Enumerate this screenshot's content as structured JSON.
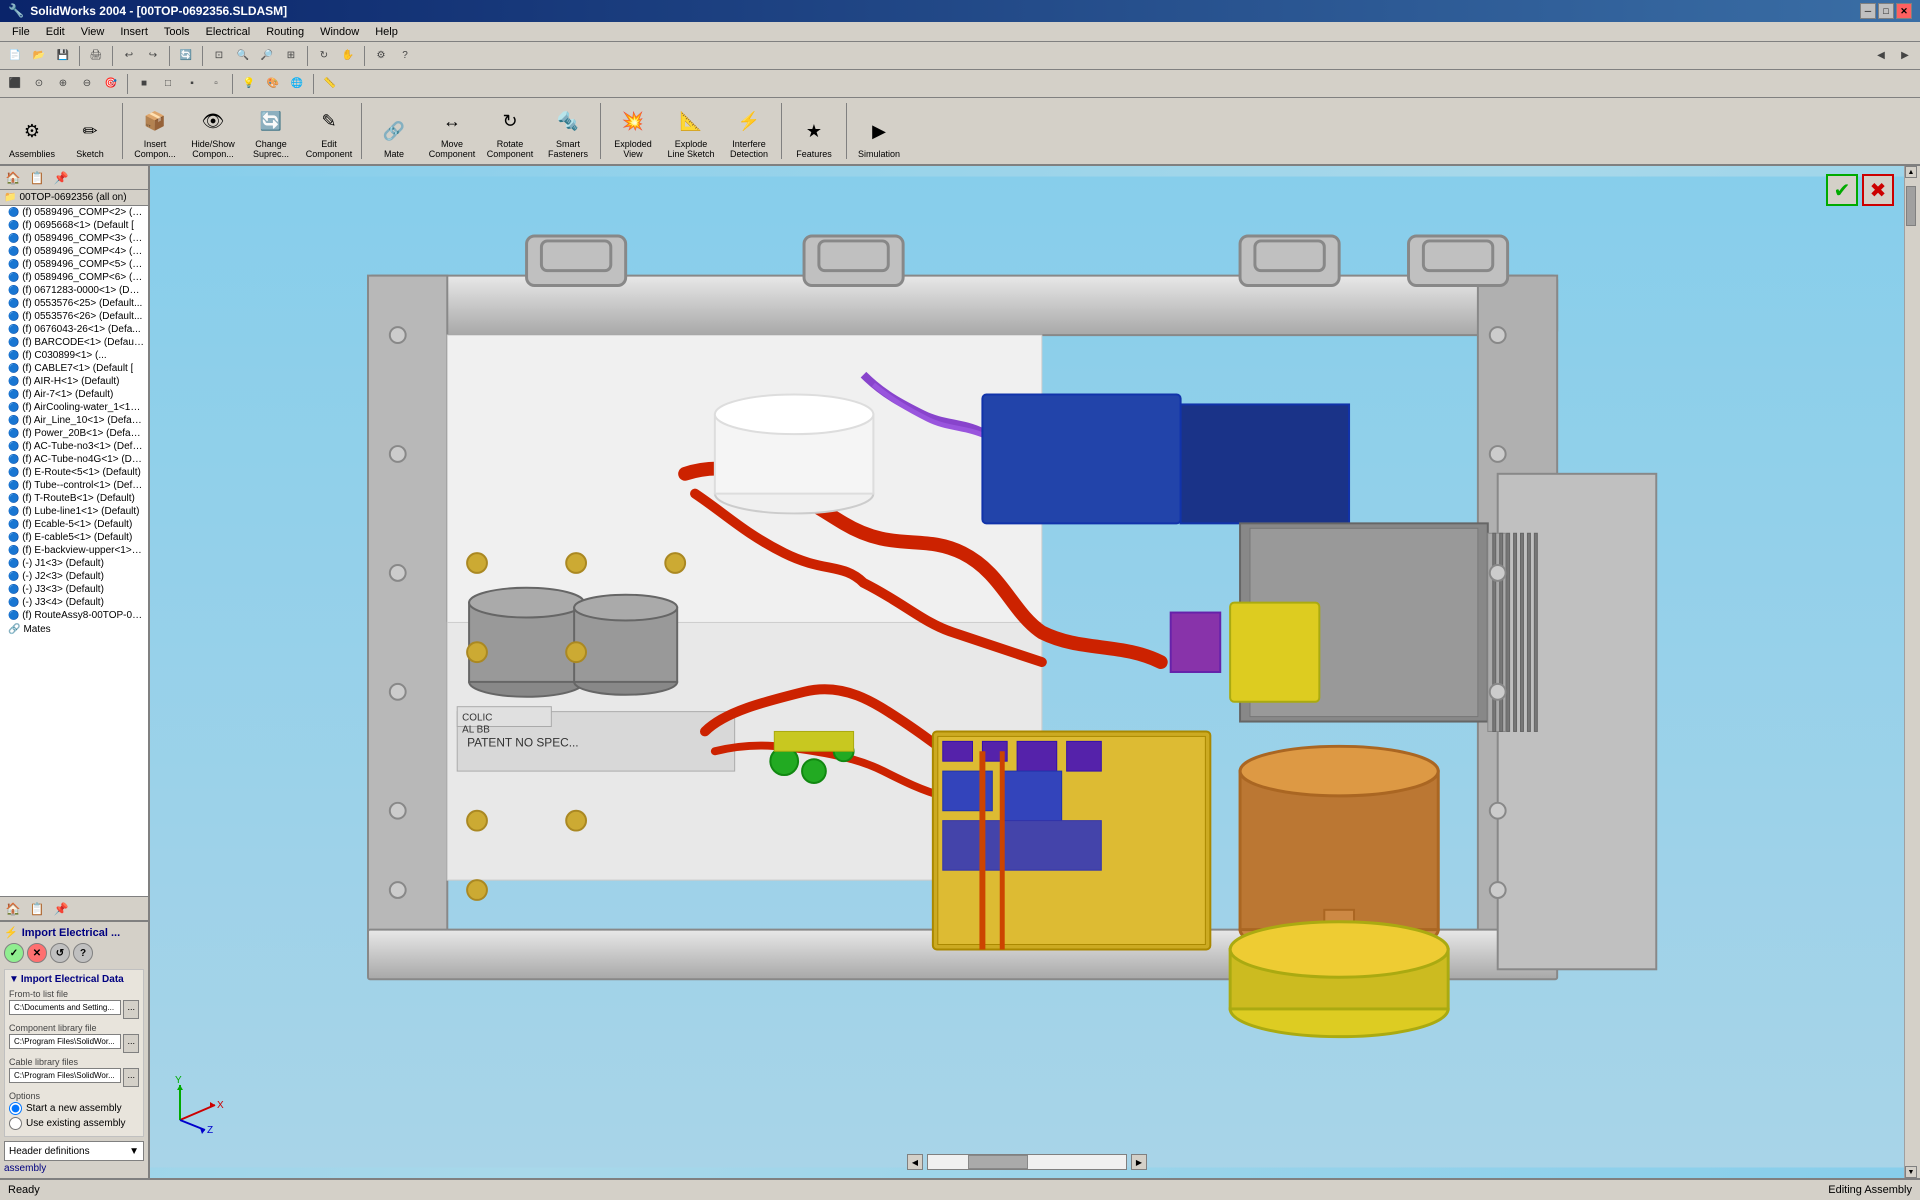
{
  "titlebar": {
    "title": "SolidWorks 2004 - [00TOP-0692356.SLDASM]",
    "min_label": "─",
    "max_label": "□",
    "close_label": "✕"
  },
  "menubar": {
    "items": [
      "File",
      "Edit",
      "View",
      "Insert",
      "Tools",
      "Electrical",
      "Routing",
      "Window",
      "Help"
    ]
  },
  "assembly_toolbar": {
    "buttons": [
      {
        "id": "assemblies",
        "label": "Assemblies",
        "icon": "⚙"
      },
      {
        "id": "sketch",
        "label": "Sketch",
        "icon": "✏"
      },
      {
        "id": "insert",
        "label": "Insert\nCompon...",
        "icon": "📦"
      },
      {
        "id": "hideshow",
        "label": "Hide/Show\nCompon...",
        "icon": "👁"
      },
      {
        "id": "change",
        "label": "Change\nSuprec...",
        "icon": "🔄"
      },
      {
        "id": "edit",
        "label": "Edit\nComponent",
        "icon": "✎"
      },
      {
        "id": "mate",
        "label": "Mate",
        "icon": "🔗"
      },
      {
        "id": "move",
        "label": "Move\nComponent",
        "icon": "↔"
      },
      {
        "id": "rotate",
        "label": "Rotate\nComponent",
        "icon": "↻"
      },
      {
        "id": "smartfasteners",
        "label": "Smart\nFasteners",
        "icon": "🔩"
      },
      {
        "id": "exploded",
        "label": "Exploded\nView",
        "icon": "💥"
      },
      {
        "id": "explode",
        "label": "Explode\nLine Sketch",
        "icon": "📐"
      },
      {
        "id": "interference",
        "label": "Interfere\nDetection",
        "icon": "⚡"
      },
      {
        "id": "features",
        "label": "Features",
        "icon": "★"
      },
      {
        "id": "simulation",
        "label": "Simulation",
        "icon": "▶"
      }
    ]
  },
  "tree": {
    "root": "00TOP-0692356 (all on)",
    "items": [
      "(f) 0589496_COMP<2> (De...",
      "(f) 0695668<1> (Default [",
      "(f) 0589496_COMP<3> (De...",
      "(f) 0589496_COMP<4> (De...",
      "(f) 0589496_COMP<5> (De...",
      "(f) 0589496_COMP<6> (De...",
      "(f) 0671283-0000<1> (Def...",
      "(f) 0553576<25> (Default...",
      "(f) 0553576<26> (Default...",
      "(f) 0676043-26<1> (Defa...",
      "(f) BARCODE<1> (Default...",
      "(f) C030899<1> (...",
      "(f) CABLE7<1> (Default [",
      "(f) AIR-H<1> (Default)",
      "(f) Air-7<1> (Default)",
      "(f) AirCooling-water_1<1>...",
      "(f) Air_Line_10<1> (Defau...",
      "(f) Power_20B<1> (Defau...",
      "(f) AC-Tube-no3<1> (Defa...",
      "(f) AC-Tube-no4G<1> (Def...",
      "(f) E-Route<5<1> (Default)",
      "(f) Tube--control<1> (Defa...",
      "(f) T-RouteB<1> (Default)",
      "(f) Lube-line1<1> (Default)",
      "(f) Ecable-5<1> (Default)",
      "(f) E-cable5<1> (Default)",
      "(f) E-backview-upper<1> (...",
      "(-) J1<3> (Default)",
      "(-) J2<3> (Default)",
      "(-) J3<3> (Default)",
      "(-) J3<4> (Default)",
      "(f) RouteAssy8-00TOP-069...",
      "Mates"
    ]
  },
  "import_panel": {
    "title": "Import Electrical ...",
    "confirm_btn": "✓",
    "cancel_btn": "✕",
    "refresh_btn": "↺",
    "help_btn": "?",
    "section_title": "Import Electrical Data",
    "from_list_label": "From-to list file",
    "from_list_value": "C:\\Documents and Setting...",
    "component_lib_label": "Component library file",
    "component_lib_value": "C:\\Program Files\\SolidWor...",
    "cable_lib_label": "Cable library files",
    "cable_lib_value": "C:\\Program Files\\SolidWor...",
    "options_label": "Options",
    "radio1_label": "Start a new assembly",
    "radio2_label": "Use existing assembly",
    "header_def_label": "Header definitions",
    "browse_label": "...",
    "assembly_label": "assembly"
  },
  "viewport": {
    "bg_color_top": "#87ceeb",
    "bg_color_bottom": "#b0d4e8"
  },
  "statusbar": {
    "status": "Ready",
    "editing": "Editing Assembly"
  },
  "toolbar1_buttons": [
    "⬛",
    "⬜",
    "⬜",
    "⬜",
    "⬜",
    "⬜",
    "⬜",
    "⬜",
    "⬜",
    "⬜",
    "⬜",
    "⬜",
    "⬜",
    "⬜",
    "⬜",
    "⬜",
    "⬜",
    "⬜",
    "⬜",
    "⬜",
    "⬜"
  ],
  "icons": {
    "check_green": "✔",
    "x_red": "✖",
    "folder": "📁",
    "component": "🔵",
    "mates": "🔗",
    "down_arrow": "▼",
    "right_arrow": "▶"
  }
}
